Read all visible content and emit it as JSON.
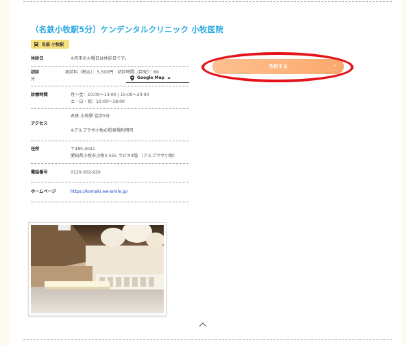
{
  "clinic": {
    "title": "（名鉄小牧駅5分）ケンデンタルクリニック 小牧医院",
    "station_badge": "名鉄 小牧駅"
  },
  "info_rows": [
    {
      "label": "休診日",
      "value": "※月末の火曜日は休診日です。"
    },
    {
      "label": "初診",
      "label2": "分",
      "value": "初診料（税込）：5,500円　初診時間（目安）：60"
    },
    {
      "label": "診療時間",
      "value": "月～金：10:00～13:00 / 15:00～20:00",
      "value2": "土・日・祝：10:00～18:00"
    },
    {
      "label": "アクセス",
      "value": "名鉄 小牧駅 徒歩5分",
      "value2": "※アルプラザ小牧の駐車場利用可"
    },
    {
      "label": "住所",
      "value": "〒485-0041",
      "value2": "愛知県小牧市小牧3-555 ラピオ4階 （アルプラザ小牧）"
    },
    {
      "label": "電話番号",
      "value": "0120-302-920"
    },
    {
      "label": "ホームページ",
      "value": "https://komaki.we-smile.jp/"
    }
  ],
  "map_link": {
    "label": "Google Map",
    "arrow": "»",
    "icon": "map-pin-icon"
  },
  "reserve_button": {
    "label": "予約する",
    "chevron": "›"
  },
  "colors": {
    "title": "#29a7e1",
    "badge": "#f7e07c",
    "button": "#fba86c",
    "highlight": "#e4141a",
    "link": "#1a44c9"
  },
  "scroll_top": {
    "icon": "chevron-up-icon"
  }
}
